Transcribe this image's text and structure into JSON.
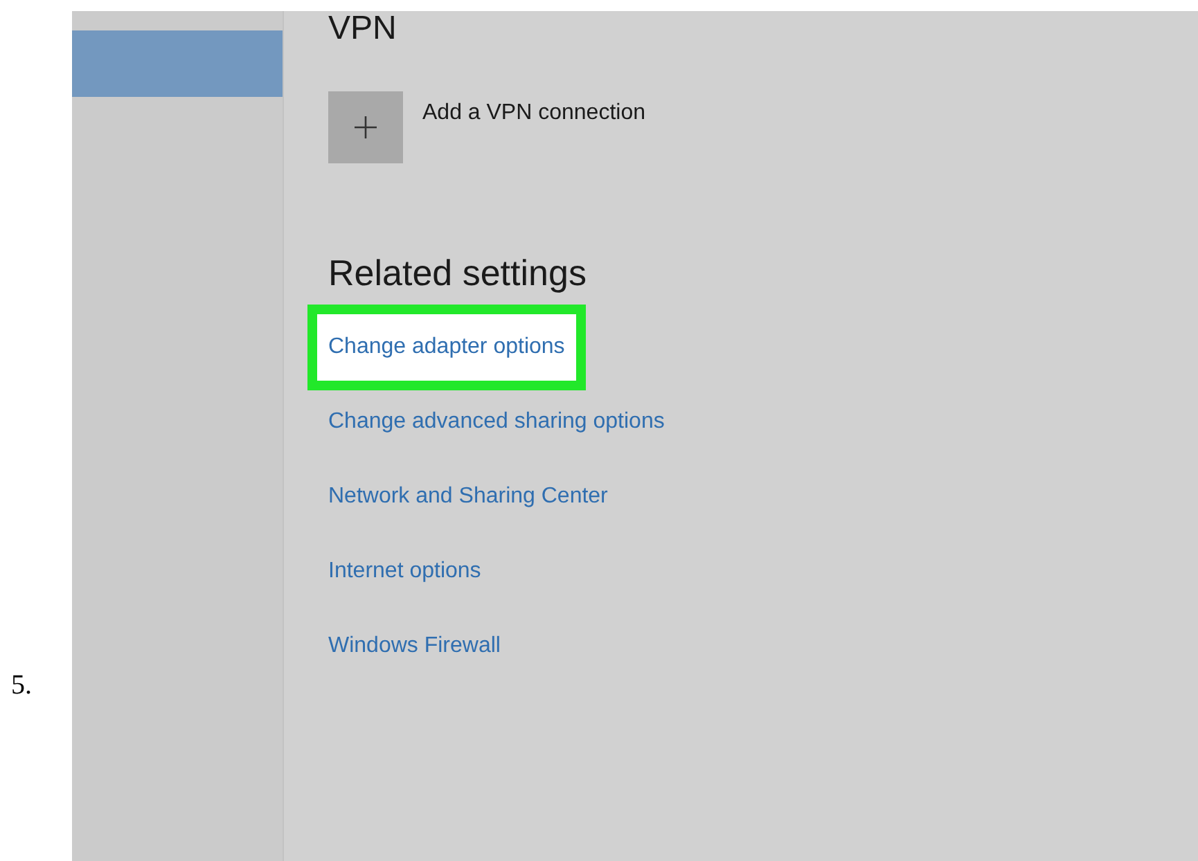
{
  "step_number": "5.",
  "sidebar": {
    "items": [
      {
        "selected": true
      }
    ]
  },
  "vpn": {
    "heading": "VPN",
    "add_label": "Add a VPN connection"
  },
  "related_settings": {
    "heading": "Related settings",
    "links": [
      {
        "label": "Change adapter options",
        "highlighted": true
      },
      {
        "label": "Change advanced sharing options",
        "highlighted": false
      },
      {
        "label": "Network and Sharing Center",
        "highlighted": false
      },
      {
        "label": "Internet options",
        "highlighted": false
      },
      {
        "label": "Windows Firewall",
        "highlighted": false
      }
    ]
  }
}
